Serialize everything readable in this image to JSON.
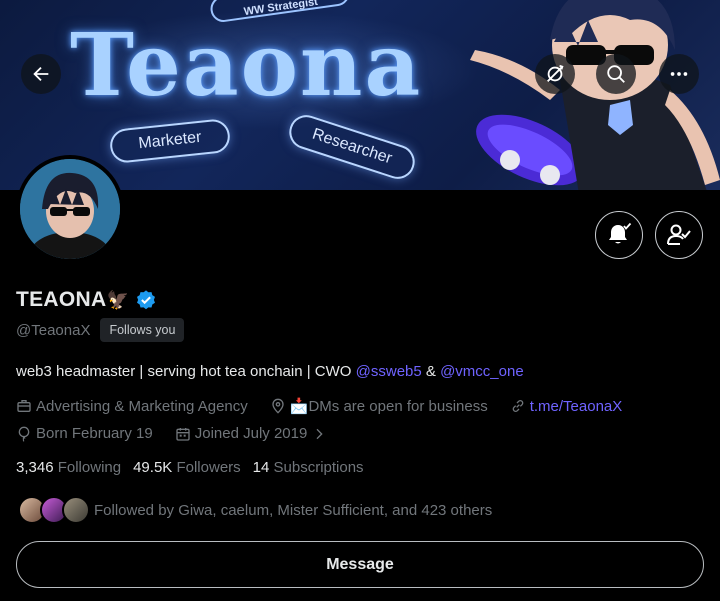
{
  "banner": {
    "title": "Teaona",
    "pretag": "WW Strategist",
    "pills": [
      "Marketer",
      "Researcher"
    ]
  },
  "header_icons": {
    "back": "arrow-left-icon",
    "mute": "mute-icon",
    "search": "search-icon",
    "more": "more-icon"
  },
  "profile": {
    "display_name": "TEAONA",
    "name_emoji": "🦅",
    "handle": "@TeaonaX",
    "follows_you": "Follows you",
    "bio_text": "web3 headmaster | serving hot tea onchain | CWO ",
    "bio_mention1": "@ssweb5",
    "bio_amp": " & ",
    "bio_mention2": "@vmcc_one",
    "category": "Advertising & Marketing Agency",
    "location": "📩DMs are open for business",
    "website": "t.me/TeaonaX",
    "born": "Born February 19",
    "joined": "Joined July 2019"
  },
  "stats": {
    "following_count": "3,346",
    "following_label": "Following",
    "followers_count": "49.5K",
    "followers_label": "Followers",
    "subscriptions_count": "14",
    "subscriptions_label": "Subscriptions"
  },
  "followed_by": "Followed by Giwa, caelum, Mister Sufficient, and 423 others",
  "message_button": "Message",
  "colors": {
    "background": "#000000",
    "text_primary": "#e7e9ea",
    "text_secondary": "#71767b",
    "link": "#6f63ff",
    "verified": "#1d9bf0"
  }
}
